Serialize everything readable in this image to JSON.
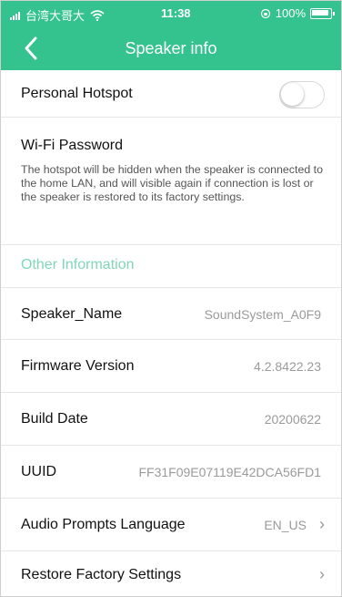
{
  "status_bar": {
    "carrier": "台湾大哥大",
    "time": "11:38",
    "battery": "100%"
  },
  "nav": {
    "title": "Speaker info",
    "back_icon": "chevron-left-icon"
  },
  "hotspot": {
    "label": "Personal Hotspot",
    "enabled": false
  },
  "wifi": {
    "label": "Wi-Fi Password",
    "description": "The hotspot will be hidden when the speaker is connected to the home LAN, and will visible again if connection is lost or the speaker is restored to its factory settings."
  },
  "other_info": {
    "header": "Other Information",
    "accent_color": "#7fd8b7"
  },
  "rows": {
    "speaker_name": {
      "label": "Speaker_Name",
      "value": "SoundSystem_A0F9"
    },
    "firmware": {
      "label": "Firmware Version",
      "value": "4.2.8422.23"
    },
    "build_date": {
      "label": "Build Date",
      "value": "20200622"
    },
    "uuid": {
      "label": "UUID",
      "value": "FF31F09E07119E42DCA56FD1"
    },
    "audio_prompts": {
      "label": "Audio Prompts Language",
      "value": "EN_US"
    },
    "restore": {
      "label": "Restore Factory Settings",
      "value": ""
    }
  },
  "colors": {
    "header_bg": "#34c38f"
  }
}
